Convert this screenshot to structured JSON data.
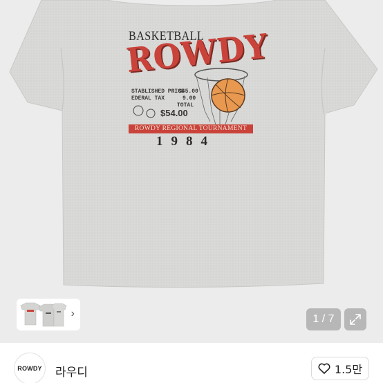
{
  "product_print": {
    "top_label": "BASKETBALL",
    "brand": "ROWDY",
    "line1_label": "STABLISHED PRICE",
    "line1_value": "$45.00",
    "line2_label": "EDERAL TAX",
    "line2_value": "9.00",
    "line3_label": "TOTAL",
    "price_total": "$54.00",
    "banner": "ROWDY REGIONAL TOURNAMENT",
    "year": "1984",
    "colors": {
      "shirt": "#d9d9d7",
      "accent_red": "#c9433a",
      "ink": "#2e2a2a"
    }
  },
  "gallery": {
    "counter": "1 / 7",
    "thumb_next_icon": "chevron-right-icon",
    "expand_icon": "expand-icon"
  },
  "seller": {
    "avatar_text": "ROWDY",
    "name": "라우디",
    "likes_icon": "heart-outline-icon",
    "likes_count": "1.5만"
  }
}
